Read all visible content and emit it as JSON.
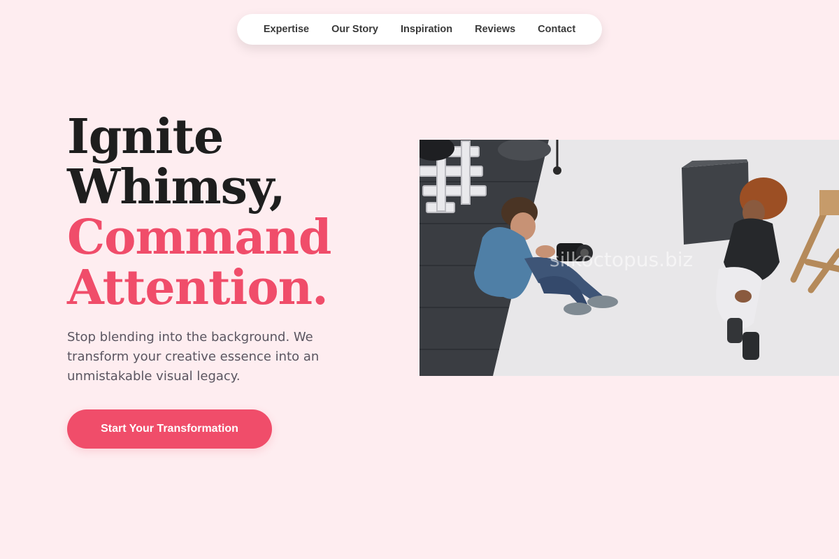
{
  "nav": {
    "items": [
      {
        "label": "Expertise"
      },
      {
        "label": "Our Story"
      },
      {
        "label": "Inspiration"
      },
      {
        "label": "Reviews"
      },
      {
        "label": "Contact"
      }
    ]
  },
  "hero": {
    "title_line1": "Ignite",
    "title_line2": "Whimsy,",
    "title_line3": "Command",
    "title_line4": "Attention.",
    "subtitle": "Stop blending into the background. We transform your creative essence into an unmistakable visual legacy.",
    "cta_label": "Start Your Transformation",
    "image_watermark": "silkoctopus.biz"
  },
  "colors": {
    "background": "#feedf0",
    "accent": "#f04d6a",
    "heading": "#1e1e1e",
    "body_text": "#5a5560",
    "nav_bg": "#ffffff"
  }
}
